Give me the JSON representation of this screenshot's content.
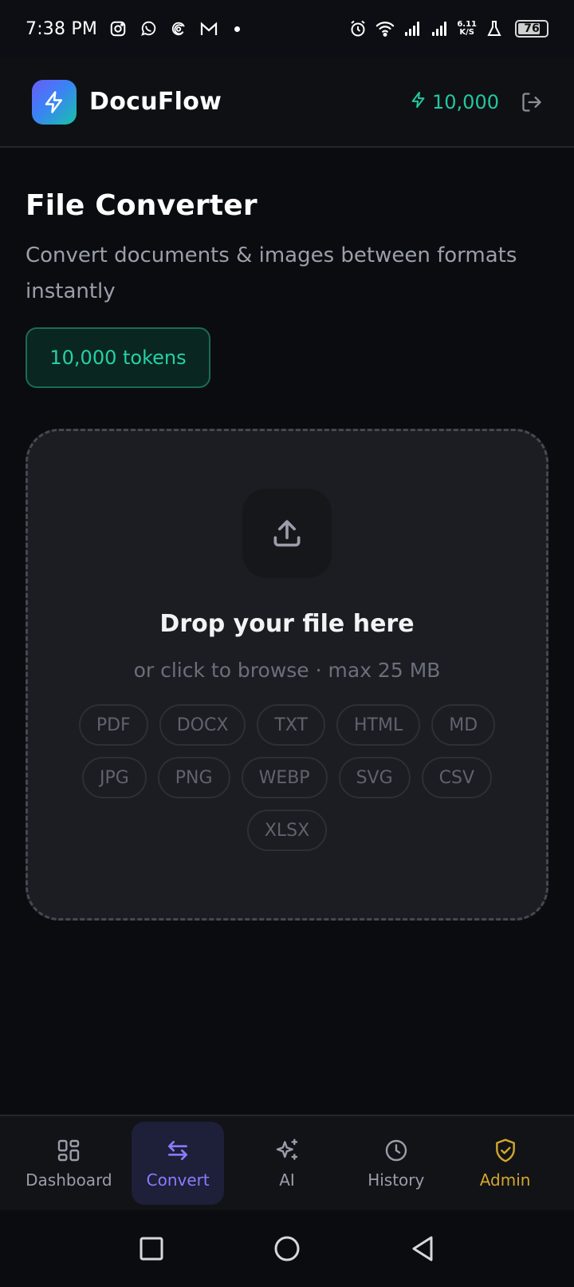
{
  "status_bar": {
    "time": "7:38 PM",
    "net_speed_top": "6.11",
    "net_speed_bottom": "K/S",
    "battery": "76",
    "icons": [
      "instagram-icon",
      "whatsapp-icon",
      "threads-icon",
      "gmail-icon",
      "alarm-icon",
      "wifi-icon",
      "signal-icon",
      "signal-icon",
      "lab-icon",
      "battery-icon"
    ]
  },
  "header": {
    "brand": "DocuFlow",
    "token_balance": "10,000",
    "accent": "#22c7a0"
  },
  "main": {
    "title": "File Converter",
    "subtitle": "Convert documents & images between formats instantly",
    "token_badge": "10,000 tokens"
  },
  "dropzone": {
    "title": "Drop your file here",
    "subtitle": "or click to browse · max 25 MB",
    "formats": [
      "PDF",
      "DOCX",
      "TXT",
      "HTML",
      "MD",
      "JPG",
      "PNG",
      "WEBP",
      "SVG",
      "CSV",
      "XLSX"
    ]
  },
  "bottom_nav": {
    "items": [
      {
        "label": "Dashboard",
        "icon": "grid-icon"
      },
      {
        "label": "Convert",
        "icon": "swap-icon",
        "active": true
      },
      {
        "label": "AI",
        "icon": "sparkle-icon"
      },
      {
        "label": "History",
        "icon": "clock-icon"
      },
      {
        "label": "Admin",
        "icon": "shield-check-icon"
      }
    ],
    "active_color": "#8b7bff",
    "admin_color": "#d4a72c"
  }
}
